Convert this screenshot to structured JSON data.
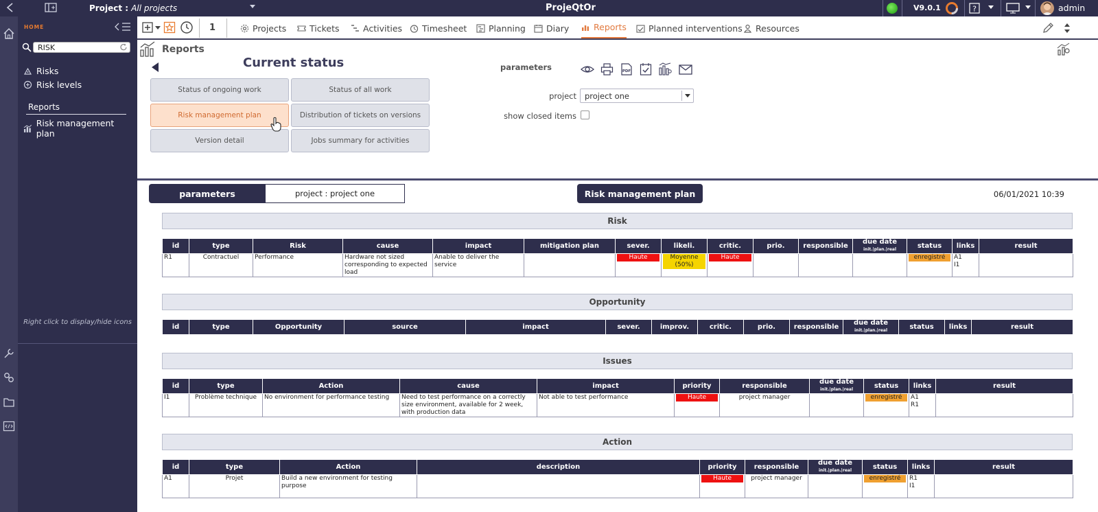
{
  "topbar": {
    "project_prefix": "Project : ",
    "project_value": "All projects",
    "app_title": "ProjeQtOr",
    "version": "V9.0.1",
    "user": "admin"
  },
  "sidebar": {
    "home": "HOME",
    "search_value": "RISK",
    "items": [
      {
        "label": "Risks",
        "icon": "risk-icon"
      },
      {
        "label": "Risk levels",
        "icon": "risk-level-icon"
      }
    ],
    "section": "Reports",
    "report_item": "Risk management plan",
    "hint": "Right click to display/hide icons"
  },
  "toolbar": {
    "counter": "1",
    "nav": [
      {
        "label": "Projects",
        "icon": "gear-icon"
      },
      {
        "label": "Tickets",
        "icon": "ticket-icon"
      },
      {
        "label": "Activities",
        "icon": "activities-icon"
      },
      {
        "label": "Timesheet",
        "icon": "timesheet-icon"
      },
      {
        "label": "Planning",
        "icon": "planning-icon"
      },
      {
        "label": "Diary",
        "icon": "calendar-icon"
      },
      {
        "label": "Reports",
        "icon": "reports-icon"
      },
      {
        "label": "Planned interventions",
        "icon": "interventions-icon"
      },
      {
        "label": "Resources",
        "icon": "resources-icon"
      }
    ]
  },
  "params": {
    "header": "Reports",
    "category": "Current status",
    "buttons": [
      "Status of ongoing work",
      "Status of all work",
      "Risk management plan",
      "Distribution of tickets on versions",
      "Version detail",
      "Jobs summary for activities"
    ],
    "parameters_label": "parameters",
    "project_label": "project",
    "project_value": "project one",
    "closed_label": "show closed items"
  },
  "report": {
    "param_btn": "parameters",
    "param_value": "project : project one",
    "title": "Risk management plan",
    "datetime": "06/01/2021 10:39",
    "subheader": "init.|plan.|real",
    "risk": {
      "title": "Risk",
      "headers": [
        "id",
        "type",
        "Risk",
        "cause",
        "impact",
        "mitigation plan",
        "sever.",
        "likeli.",
        "critic.",
        "prio.",
        "responsible",
        "due date",
        "status",
        "links",
        "result"
      ],
      "row": {
        "id": "R1",
        "type": "Contractuel",
        "name": "Performance",
        "cause": "Hardware not sized corresponding to expected load",
        "impact": "Anable to deliver the service",
        "mitigation": "",
        "severity": "Haute",
        "likelihood": "Moyenne (50%)",
        "criticality": "Haute",
        "priority": "",
        "responsible": "",
        "due": "",
        "status": "enregistré",
        "links": [
          "A1",
          "I1"
        ],
        "result": ""
      }
    },
    "opportunity": {
      "title": "Opportunity",
      "headers": [
        "id",
        "type",
        "Opportunity",
        "source",
        "impact",
        "sever.",
        "improv.",
        "critic.",
        "prio.",
        "responsible",
        "due date",
        "status",
        "links",
        "result"
      ]
    },
    "issues": {
      "title": "Issues",
      "headers": [
        "id",
        "type",
        "Action",
        "cause",
        "impact",
        "priority",
        "responsible",
        "due date",
        "status",
        "links",
        "result"
      ],
      "row": {
        "id": "I1",
        "type": "Problème technique",
        "action": "No environment for performance testing",
        "cause": "Need to test performance on a correctly size environment, available for 2 week, with production data",
        "impact": "Not able to test performance",
        "priority": "Haute",
        "responsible": "project manager",
        "due": "",
        "status": "enregistré",
        "links": [
          "A1",
          "R1"
        ],
        "result": ""
      }
    },
    "action": {
      "title": "Action",
      "headers": [
        "id",
        "type",
        "Action",
        "description",
        "priority",
        "responsible",
        "due date",
        "status",
        "links",
        "result"
      ],
      "row": {
        "id": "A1",
        "type": "Projet",
        "action": "Build a new environment for testing purpose",
        "description": "",
        "priority": "Haute",
        "responsible": "project manager",
        "due": "",
        "status": "enregistré",
        "links": [
          "R1",
          "I1"
        ],
        "result": ""
      }
    }
  },
  "colors": {
    "dark": "#2e2e4c",
    "accent": "#e27a3f",
    "red_tag": "#ee1111",
    "yellow_tag": "#f5d400",
    "orange_tag": "#f0a030"
  }
}
